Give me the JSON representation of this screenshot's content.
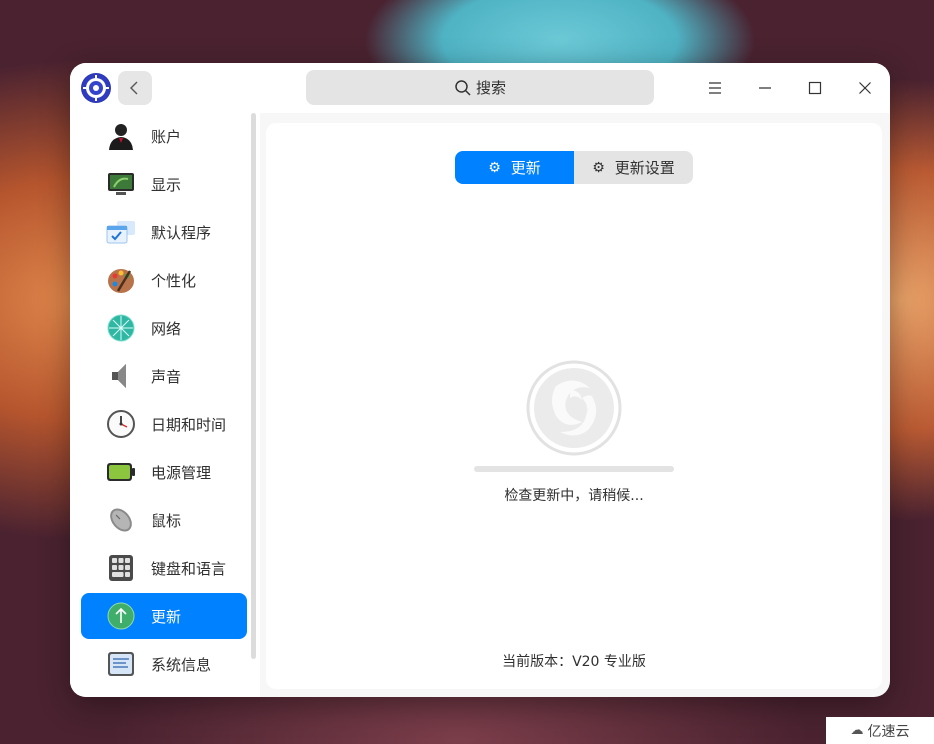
{
  "window": {
    "search_icon": "search-icon",
    "search_label": "搜索",
    "back_icon": "chevron-left-icon",
    "menu_icon": "menu-icon",
    "minimize_icon": "minimize-icon",
    "maximize_icon": "maximize-icon",
    "close_icon": "close-icon"
  },
  "sidebar": {
    "items": [
      {
        "label": "账户",
        "icon": "user-account-icon"
      },
      {
        "label": "显示",
        "icon": "display-monitor-icon"
      },
      {
        "label": "默认程序",
        "icon": "default-apps-icon"
      },
      {
        "label": "个性化",
        "icon": "palette-icon"
      },
      {
        "label": "网络",
        "icon": "network-globe-icon"
      },
      {
        "label": "声音",
        "icon": "speaker-icon"
      },
      {
        "label": "日期和时间",
        "icon": "clock-icon"
      },
      {
        "label": "电源管理",
        "icon": "battery-icon"
      },
      {
        "label": "鼠标",
        "icon": "mouse-icon"
      },
      {
        "label": "键盘和语言",
        "icon": "keyboard-icon"
      },
      {
        "label": "更新",
        "icon": "update-arrow-icon"
      },
      {
        "label": "系统信息",
        "icon": "system-info-icon"
      }
    ],
    "active_index": 10
  },
  "content": {
    "tabs": [
      {
        "label": "更新",
        "icon": "gear-icon",
        "active": true
      },
      {
        "label": "更新设置",
        "icon": "gear-icon",
        "active": false
      }
    ],
    "status_text": "检查更新中，请稍候...",
    "version_text": "当前版本：V20 专业版"
  },
  "watermark": {
    "text": "亿速云",
    "icon": "cloud-logo-icon"
  },
  "colors": {
    "accent": "#0081ff",
    "window_bg": "#f7f7f7",
    "text": "#303030"
  }
}
